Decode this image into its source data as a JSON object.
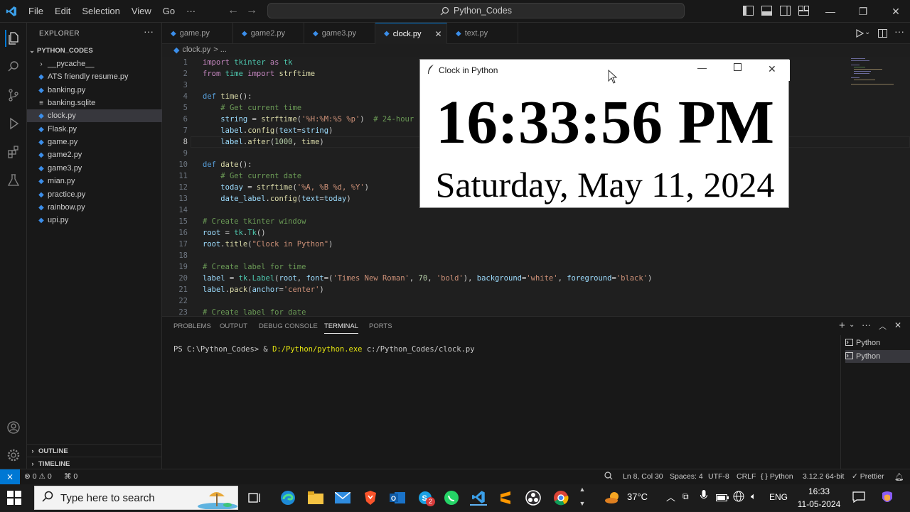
{
  "titlebar": {
    "menu": [
      "File",
      "Edit",
      "Selection",
      "View",
      "Go",
      "···"
    ],
    "search": "Python_Codes"
  },
  "sidebar": {
    "header": "EXPLORER",
    "folder": "PYTHON_CODES",
    "files": [
      {
        "name": "__pycache__",
        "type": "folder"
      },
      {
        "name": "ATS friendly resume.py",
        "type": "py"
      },
      {
        "name": "banking.py",
        "type": "py"
      },
      {
        "name": "banking.sqlite",
        "type": "db"
      },
      {
        "name": "clock.py",
        "type": "py",
        "active": true
      },
      {
        "name": "Flask.py",
        "type": "py"
      },
      {
        "name": "game.py",
        "type": "py"
      },
      {
        "name": "game2.py",
        "type": "py"
      },
      {
        "name": "game3.py",
        "type": "py"
      },
      {
        "name": "mian.py",
        "type": "py"
      },
      {
        "name": "practice.py",
        "type": "py"
      },
      {
        "name": "rainbow.py",
        "type": "py"
      },
      {
        "name": "upi.py",
        "type": "py"
      }
    ],
    "outline": "OUTLINE",
    "timeline": "TIMELINE"
  },
  "tabs": [
    "game.py",
    "game2.py",
    "game3.py",
    "clock.py",
    "text.py"
  ],
  "breadcrumb": {
    "file": "clock.py",
    "more": "> ..."
  },
  "code": {
    "line_numbers": [
      "1",
      "2",
      "3",
      "4",
      "5",
      "6",
      "7",
      "8",
      "9",
      "10",
      "11",
      "12",
      "13",
      "14",
      "15",
      "16",
      "17",
      "18",
      "19",
      "20",
      "21",
      "22",
      "23"
    ],
    "current_line": "8"
  },
  "panel": {
    "tabs": [
      "PROBLEMS",
      "OUTPUT",
      "DEBUG CONSOLE",
      "TERMINAL",
      "PORTS"
    ],
    "active_tab": "TERMINAL",
    "terminal_prompt": "PS C:\\Python_Codes> & ",
    "terminal_exe": "D:/Python/python.exe",
    "terminal_arg": " c:/Python_Codes/clock.py",
    "terminals": [
      "Python",
      "Python"
    ]
  },
  "statusbar": {
    "errors": "0",
    "warnings": "0",
    "ports": "0",
    "position": "Ln 8, Col 30",
    "spaces": "Spaces: 4",
    "encoding": "UTF-8",
    "eol": "CRLF",
    "language": "Python",
    "interpreter": "3.12.2 64-bit",
    "formatter": "Prettier"
  },
  "tk_window": {
    "title": "Clock in Python",
    "time": "16:33:56 PM",
    "date": "Saturday, May 11, 2024"
  },
  "taskbar": {
    "search_placeholder": "Type here to search",
    "weather": "37°C",
    "language": "ENG",
    "time": "16:33",
    "date": "11-05-2024",
    "outlook_badge": "2"
  },
  "colors": {
    "accent": "#0078d4",
    "editor_bg": "#1f1f1f",
    "chrome_bg": "#181818"
  }
}
